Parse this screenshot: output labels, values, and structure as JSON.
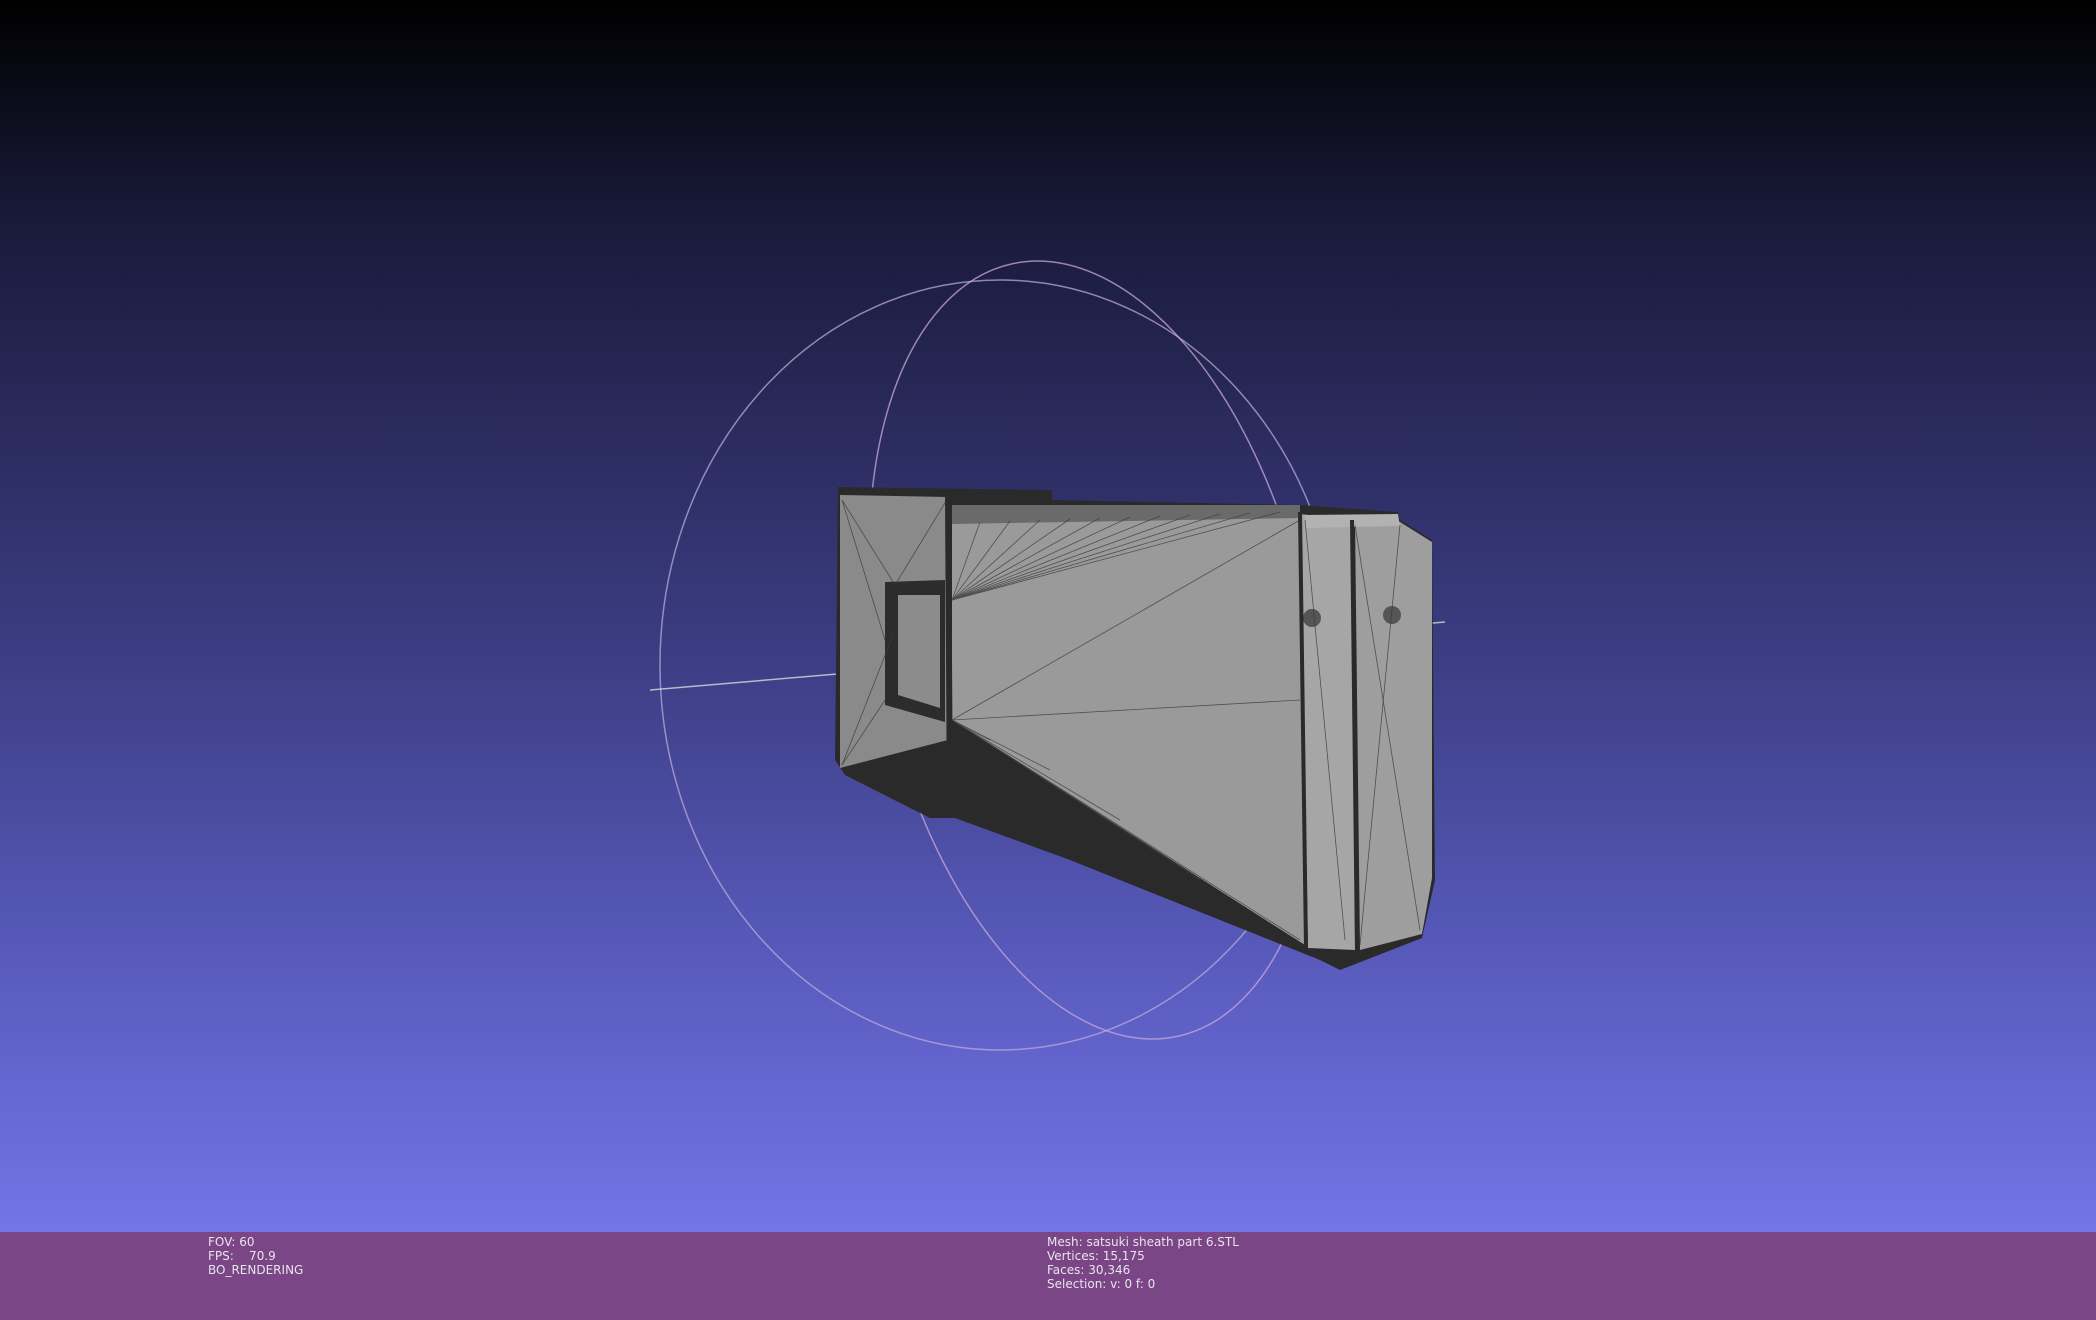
{
  "viewer": {
    "background_gradient": [
      "#000000",
      "#2b2b5e",
      "#7474e8"
    ],
    "info_bar_color": "#7b4685",
    "mesh_color": "#9a9a9a"
  },
  "render_info": {
    "fov": "FOV: 60",
    "fps": "FPS:    70.9",
    "mode": "BO_RENDERING"
  },
  "mesh_info": {
    "name": "Mesh: satsuki sheath part 6.STL",
    "vertices": "Vertices: 15,175",
    "faces": "Faces: 30,346",
    "selection": "Selection: v: 0 f: 0"
  },
  "trackball": {
    "icon": "trackball-rotation-gizmo"
  }
}
